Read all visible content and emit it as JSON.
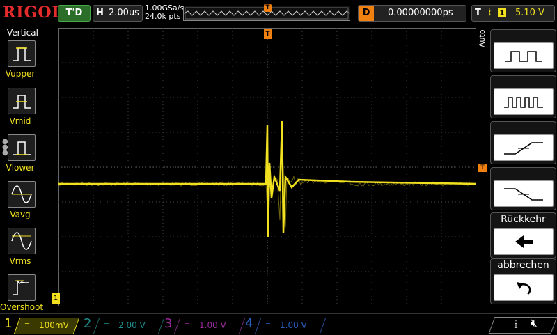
{
  "header": {
    "logo": "RIGOL",
    "run_status": "T'D",
    "horizontal_key": "H",
    "timebase": "2.00us",
    "sample_rate": "1.00GSa/s",
    "memory_depth": "24.0k pts",
    "trigger_pos_marker": "T",
    "delay_key": "D",
    "delay_value": "0.00000000ps",
    "trigger_key": "T",
    "trigger_edge": "f",
    "trigger_channel": "1",
    "trigger_level": "5.10 V"
  },
  "left_menu": {
    "title": "Vertical",
    "items": [
      {
        "label": "Vupper",
        "icon": "pulse-upper-icon"
      },
      {
        "label": "Vmid",
        "icon": "pulse-mid-icon"
      },
      {
        "label": "Vlower",
        "icon": "pulse-lower-icon"
      },
      {
        "label": "Vavg",
        "icon": "sine-avg-icon"
      },
      {
        "label": "Vrms",
        "icon": "sine-rms-icon"
      },
      {
        "label": "Overshoot",
        "icon": "overshoot-icon"
      }
    ]
  },
  "right_menu": {
    "mode_label": "Auto",
    "buttons": [
      {
        "label": "",
        "icon": "square-wave-icon"
      },
      {
        "label": "",
        "icon": "pulse-train-icon"
      },
      {
        "label": "",
        "icon": "rising-edge-icon"
      },
      {
        "label": "",
        "icon": "falling-edge-icon"
      },
      {
        "label": "Rückkehr",
        "icon": "back-arrow-icon"
      },
      {
        "label": "abbrechen",
        "icon": "undo-icon"
      }
    ]
  },
  "channels": [
    {
      "num": "1",
      "scale": "100mV",
      "color": "#f0e020",
      "active": true
    },
    {
      "num": "2",
      "scale": "2.00 V",
      "color": "#1f8f8f",
      "active": false
    },
    {
      "num": "3",
      "scale": "1.00 V",
      "color": "#9a2a9a",
      "active": false
    },
    {
      "num": "4",
      "scale": "1.00 V",
      "color": "#2a5fbf",
      "active": false
    }
  ],
  "markers": {
    "channel1_ground": "1",
    "trigger_level_marker": "T"
  },
  "status": {
    "usb_icon": "usb-icon",
    "mute_icon": "speaker-muted-icon"
  }
}
